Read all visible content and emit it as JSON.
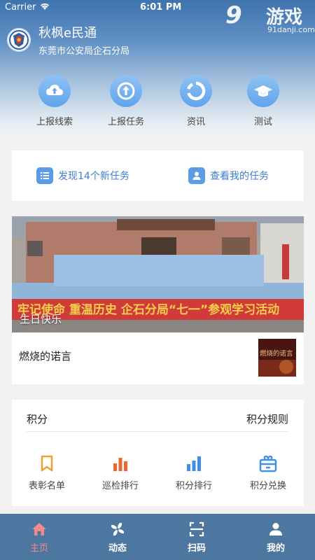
{
  "status_bar": {
    "carrier": "Carrier",
    "time": "6:01 PM"
  },
  "watermark": {
    "number": "9",
    "cn": "游戏",
    "url": "91danji.com"
  },
  "header": {
    "title": "秋枫e民通",
    "subtitle": "东莞市公安局企石分局"
  },
  "quick_actions": [
    {
      "label": "上报线索",
      "icon": "cloud-upload-icon"
    },
    {
      "label": "上报任务",
      "icon": "arrow-up-circle-icon"
    },
    {
      "label": "资讯",
      "icon": "refresh-circle-icon"
    },
    {
      "label": "测试",
      "icon": "graduation-cap-icon"
    }
  ],
  "tasks": {
    "new_tasks": "发现14个新任务",
    "my_tasks": "查看我的任务"
  },
  "news": {
    "banner_text": "牢记使命 重温历史 企石分局“七一”参观学习活动",
    "caption": "生日快乐",
    "title": "燃烧的诺言",
    "thumb_text": "燃烧的诺言"
  },
  "points": {
    "title": "积分",
    "rules": "积分规则",
    "items": [
      {
        "label": "表彰名单",
        "icon": "bookmark-icon",
        "color": "#f0a030"
      },
      {
        "label": "巡检排行",
        "icon": "bar-chart-icon",
        "color": "#ee6633"
      },
      {
        "label": "积分排行",
        "icon": "bar-chart-icon",
        "color": "#3f8fe6"
      },
      {
        "label": "积分兑换",
        "icon": "gift-icon",
        "color": "#3f8fe6"
      }
    ]
  },
  "tab_bar": [
    {
      "label": "主页",
      "icon": "home-icon",
      "active": true
    },
    {
      "label": "动态",
      "icon": "pinwheel-icon",
      "active": false
    },
    {
      "label": "扫码",
      "icon": "scan-icon",
      "active": false
    },
    {
      "label": "我的",
      "icon": "user-icon",
      "active": false
    }
  ],
  "colors": {
    "accent": "#3c7fd6",
    "tab_bar": "#4d77a0",
    "tab_active": "#f08b8b"
  }
}
